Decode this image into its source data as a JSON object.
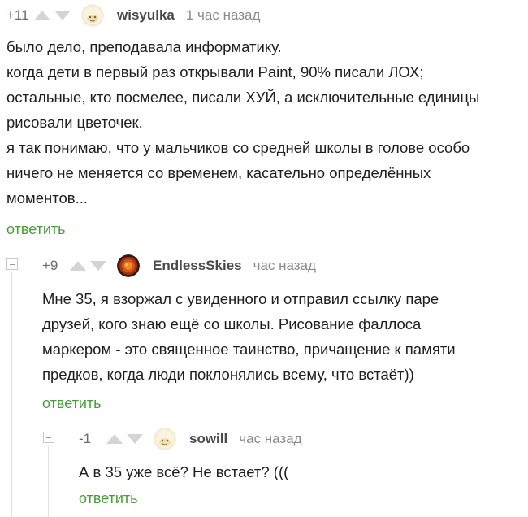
{
  "comments": [
    {
      "rating": "+11",
      "username": "wisyulka",
      "time": "1 час назад",
      "lines": [
        "было дело, преподавала информатику.",
        "когда дети в первый раз открывали Paint, 90% писали ЛОХ;",
        "остальные, кто посмелее, писали ХУЙ, а исключительные единицы",
        "рисовали цветочек.",
        "я так понимаю, что у мальчиков со средней школы в голове особо",
        "ничего не меняется со временем, касательно определённых",
        "моментов..."
      ],
      "reply": "ответить"
    },
    {
      "rating": "+9",
      "username": "EndlessSkies",
      "time": "час назад",
      "lines": [
        "Мне 35, я взоржал с увиденного и отправил ссылку паре",
        "друзей, кого знаю ещё со школы. Рисование фаллоса",
        "маркером - это священное таинство, причащение к памяти",
        "предков, когда люди поклонялись всему, что встаёт))"
      ],
      "reply": "ответить"
    },
    {
      "rating": "-1",
      "username": "sowill",
      "time": "час назад",
      "lines": [
        "А в 35 уже всё? Не встает? ((("
      ],
      "reply": "ответить"
    }
  ],
  "icons": {
    "upvote": "arrow-up-icon",
    "downvote": "arrow-down-icon",
    "collapse": "collapse-icon"
  },
  "colors": {
    "reply_link": "#4b9b3c",
    "vote_arrow": "#d4d4d4",
    "text": "#1f1f1f",
    "meta": "#8a8a8a"
  }
}
